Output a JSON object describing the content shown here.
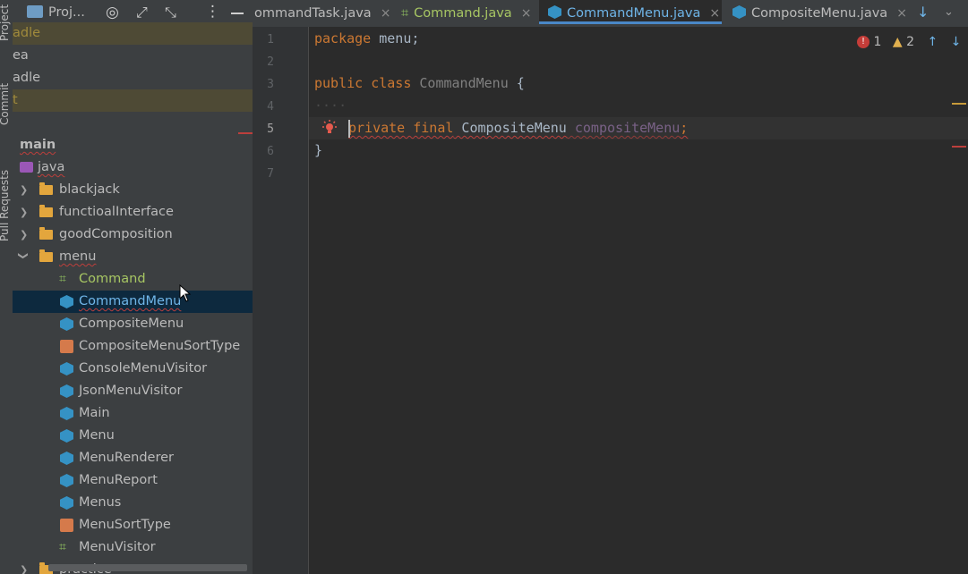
{
  "toolstrip": {
    "project": "Project",
    "commit": "Commit",
    "pull_requests": "Pull Requests"
  },
  "project_panel": {
    "title": "Proj...",
    "rows": [
      {
        "label": "adle",
        "highlight": "yellow"
      },
      {
        "label": "ea"
      },
      {
        "label": "adle"
      },
      {
        "label": "t",
        "highlight": "yellow"
      },
      {
        "label": ""
      },
      {
        "label": "main"
      },
      {
        "label": "java"
      },
      {
        "label": "blackjack"
      },
      {
        "label": "functioalInterface"
      },
      {
        "label": "goodComposition"
      },
      {
        "label": "menu"
      },
      {
        "label": "Command"
      },
      {
        "label": "CommandMenu"
      },
      {
        "label": "CompositeMenu"
      },
      {
        "label": "CompositeMenuSortType"
      },
      {
        "label": "ConsoleMenuVisitor"
      },
      {
        "label": "JsonMenuVisitor"
      },
      {
        "label": "Main"
      },
      {
        "label": "Menu"
      },
      {
        "label": "MenuRenderer"
      },
      {
        "label": "MenuReport"
      },
      {
        "label": "Menus"
      },
      {
        "label": "MenuSortType"
      },
      {
        "label": "MenuVisitor"
      },
      {
        "label": "practice"
      }
    ]
  },
  "tabs": [
    {
      "label": "ommandTask.java",
      "close": "×"
    },
    {
      "label": "Command.java",
      "close": "×"
    },
    {
      "label": "CommandMenu.java",
      "close": "×"
    },
    {
      "label": "CompositeMenu.java",
      "close": "×"
    }
  ],
  "inspections": {
    "errors": "1",
    "warnings": "2"
  },
  "line_numbers": [
    "1",
    "2",
    "3",
    "4",
    "5",
    "6",
    "7"
  ],
  "code": {
    "l1_kw": "package",
    "l1_rest": " menu;",
    "l3_kw": "public class",
    "l3_name": " CommandMenu",
    "l3_rest": " {",
    "l4_dots": "····",
    "l5_kw": "private final",
    "l5_type": " CompositeMenu",
    "l5_field": " compositeMenu",
    "l5_semi": ";",
    "l6": "}"
  },
  "colors": {
    "accent": "#4a88c7",
    "keyword": "#cc7832",
    "error": "#bc3f3c",
    "warning": "#e0b04f"
  }
}
